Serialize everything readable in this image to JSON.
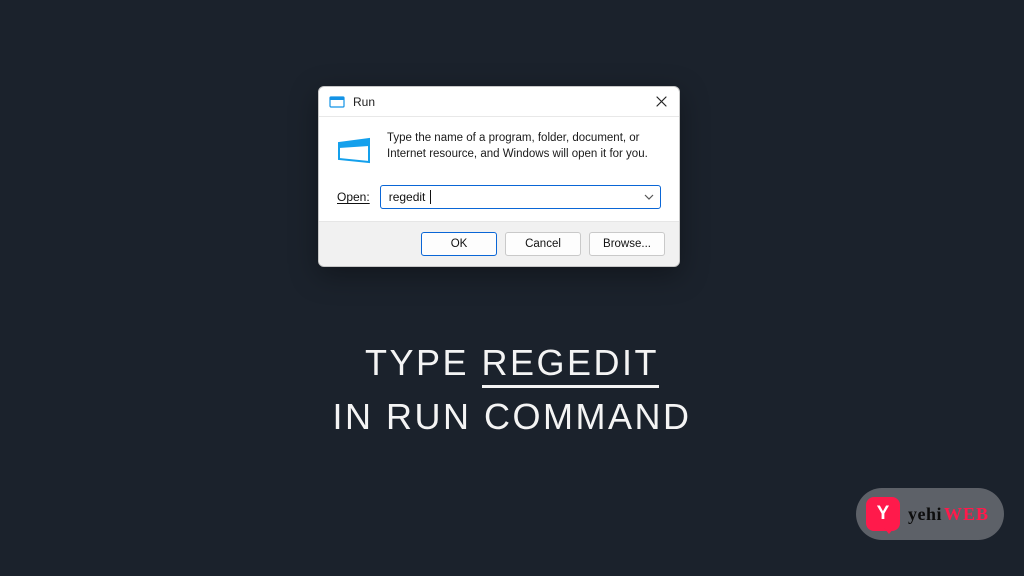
{
  "dialog": {
    "title": "Run",
    "description": "Type the name of a program, folder, document, or Internet resource, and Windows will open it for you.",
    "open_label": "Open:",
    "open_value": "regedit",
    "buttons": {
      "ok": "OK",
      "cancel": "Cancel",
      "browse": "Browse..."
    }
  },
  "caption": {
    "prefix": "TYPE ",
    "highlight": "REGEDIT",
    "line2": "IN RUN COMMAND"
  },
  "logo": {
    "letter": "Y",
    "text1": "yehi",
    "text2": "WEB"
  }
}
